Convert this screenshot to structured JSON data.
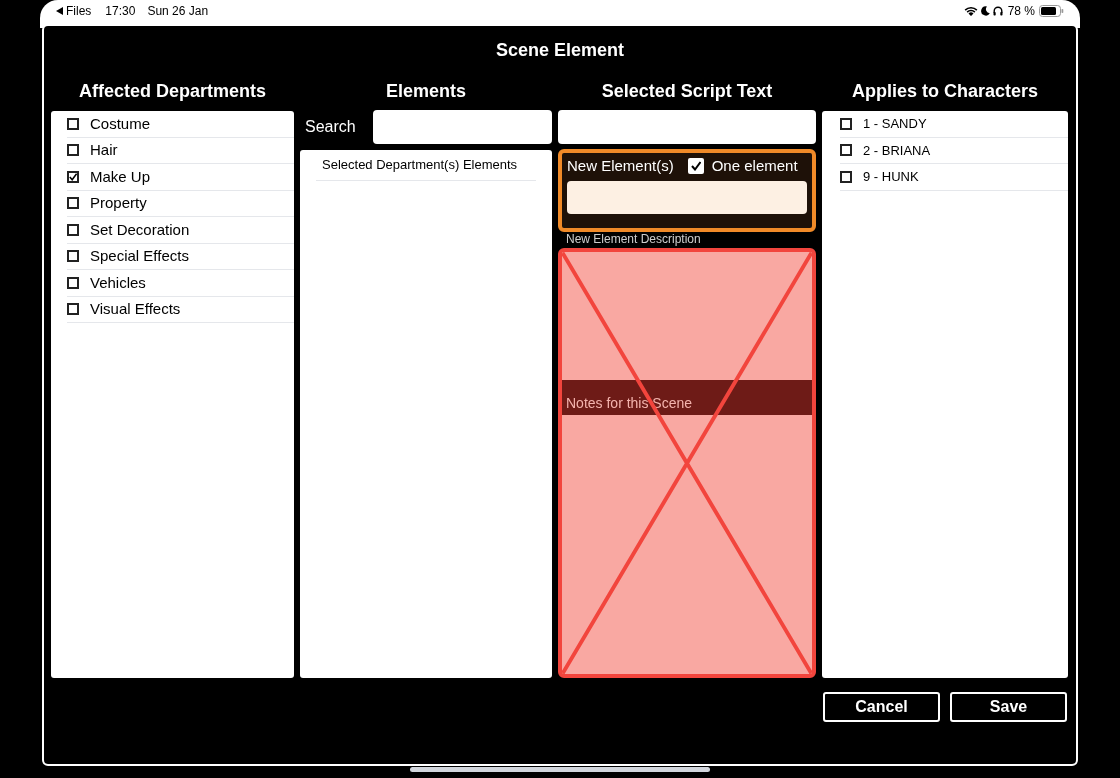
{
  "status_bar": {
    "back_label": "Files",
    "time": "17:30",
    "date": "Sun 26 Jan",
    "battery": "78 %"
  },
  "dialog": {
    "title": "Scene Element"
  },
  "departments": {
    "header": "Affected Departments",
    "items": [
      {
        "label": "Costume",
        "checked": false
      },
      {
        "label": "Hair",
        "checked": false
      },
      {
        "label": "Make Up",
        "checked": true
      },
      {
        "label": "Property",
        "checked": false
      },
      {
        "label": "Set Decoration",
        "checked": false
      },
      {
        "label": "Special Effects",
        "checked": false
      },
      {
        "label": "Vehicles",
        "checked": false
      },
      {
        "label": "Visual Effects",
        "checked": false
      }
    ]
  },
  "elements": {
    "header": "Elements",
    "search_label": "Search",
    "list_header": "Selected Department(s) Elements"
  },
  "script_text": {
    "header": "Selected Script Text",
    "new_elements_label": "New Element(s)",
    "one_element": {
      "label": "One element",
      "checked": true
    },
    "description_label": "New Element Description",
    "notes_label": "Notes for this Scene"
  },
  "characters": {
    "header": "Applies to Characters",
    "items": [
      {
        "label": "1 - SANDY",
        "checked": false
      },
      {
        "label": "2 - BRIANA",
        "checked": false
      },
      {
        "label": "9 - HUNK",
        "checked": false
      }
    ]
  },
  "buttons": [
    {
      "label": "Cancel"
    },
    {
      "label": "Save"
    }
  ]
}
